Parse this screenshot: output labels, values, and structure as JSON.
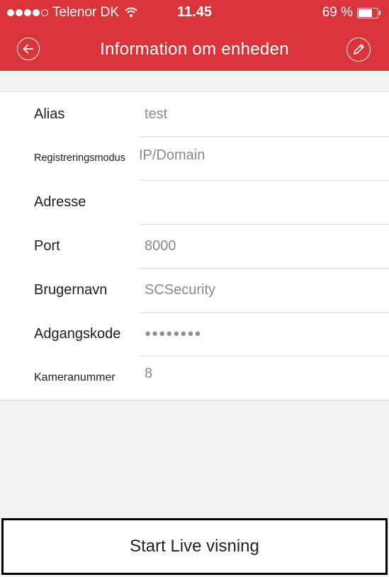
{
  "status_bar": {
    "carrier": "Telenor DK",
    "time": "11.45",
    "battery": "69 %",
    "battery_level": 0.69
  },
  "nav": {
    "title": "Information om enheden"
  },
  "fields": [
    {
      "label": "Alias",
      "value": "test"
    },
    {
      "label": "Registreringsmodus",
      "value": "IP/Domain"
    },
    {
      "label": "Adresse",
      "value": ""
    },
    {
      "label": "Port",
      "value": "8000"
    },
    {
      "label": "Brugernavn",
      "value": "SCSecurity"
    },
    {
      "label": "Adgangskode",
      "value": "●●●●●●●●"
    },
    {
      "label": "Kameranummer",
      "value": "8"
    }
  ],
  "start_button": "Start Live visning"
}
